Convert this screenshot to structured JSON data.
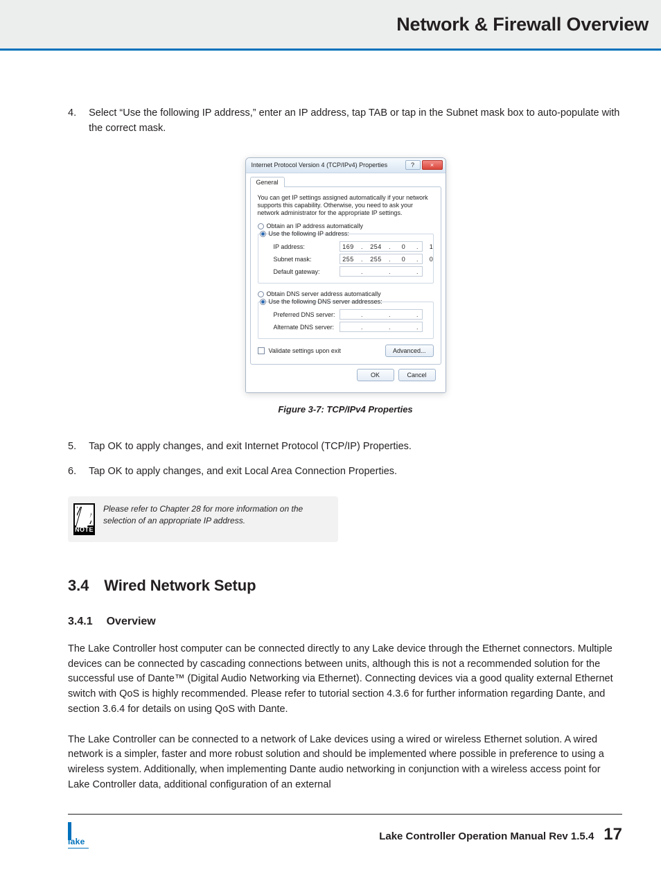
{
  "header": {
    "title": "Network & Firewall Overview"
  },
  "steps_top": [
    {
      "num": "4.",
      "text": "Select “Use the following IP address,” enter an IP address, tap TAB or tap in the Subnet mask box to auto-populate with the correct mask."
    }
  ],
  "dialog": {
    "title": "Internet Protocol Version 4 (TCP/IPv4) Properties",
    "help_glyph": "?",
    "close_glyph": "×",
    "tab": "General",
    "intro": "You can get IP settings assigned automatically if your network supports this capability. Otherwise, you need to ask your network administrator for the appropriate IP settings.",
    "opt_auto_ip": "Obtain an IP address automatically",
    "opt_static_ip": "Use the following IP address:",
    "ip_label": "IP address:",
    "ip": [
      "169",
      "254",
      "0",
      "1"
    ],
    "mask_label": "Subnet mask:",
    "mask": [
      "255",
      "255",
      "0",
      "0"
    ],
    "gw_label": "Default gateway:",
    "opt_auto_dns": "Obtain DNS server address automatically",
    "opt_static_dns": "Use the following DNS server addresses:",
    "dns1_label": "Preferred DNS server:",
    "dns2_label": "Alternate DNS server:",
    "validate": "Validate settings upon exit",
    "advanced": "Advanced...",
    "ok": "OK",
    "cancel": "Cancel"
  },
  "caption": "Figure 3-7: TCP/IPv4 Properties",
  "steps_bottom": [
    {
      "num": "5.",
      "text": "Tap OK to apply changes, and exit Internet Protocol (TCP/IP) Properties."
    },
    {
      "num": "6.",
      "text": "Tap OK to apply changes, and exit Local Area Connection Properties."
    }
  ],
  "note": {
    "label": "NOTE",
    "text": "Please refer to Chapter 28 for more information on the selection of an appropriate IP address."
  },
  "section": {
    "num": "3.4",
    "title": "Wired Network Setup"
  },
  "subsection": {
    "num": "3.4.1",
    "title": "Overview"
  },
  "para1": "The Lake Controller host computer can be connected directly to any Lake device through the Ethernet connectors. Multiple devices can be connected by cascading connections between units, although this is not a recommended solution for the successful use of Dante™ (Digital Audio Networking via Ethernet). Connecting devices via a good quality external Ethernet switch with QoS is highly recommended. Please refer to tutorial section 4.3.6 for further information regarding Dante, and section 3.6.4 for details on using QoS with Dante.",
  "para2": "The Lake Controller can be connected to a network of Lake devices using a wired or wireless Ethernet solution. A wired network is a simpler, faster and more robust solution and should be implemented where possible in preference to using a wireless system. Additionally, when implementing Dante audio networking in conjunction with a wireless access point for Lake Controller data, additional configuration of an external",
  "footer": {
    "logo_text": "lake",
    "manual": "Lake Controller Operation Manual Rev 1.5.4",
    "page": "17"
  }
}
